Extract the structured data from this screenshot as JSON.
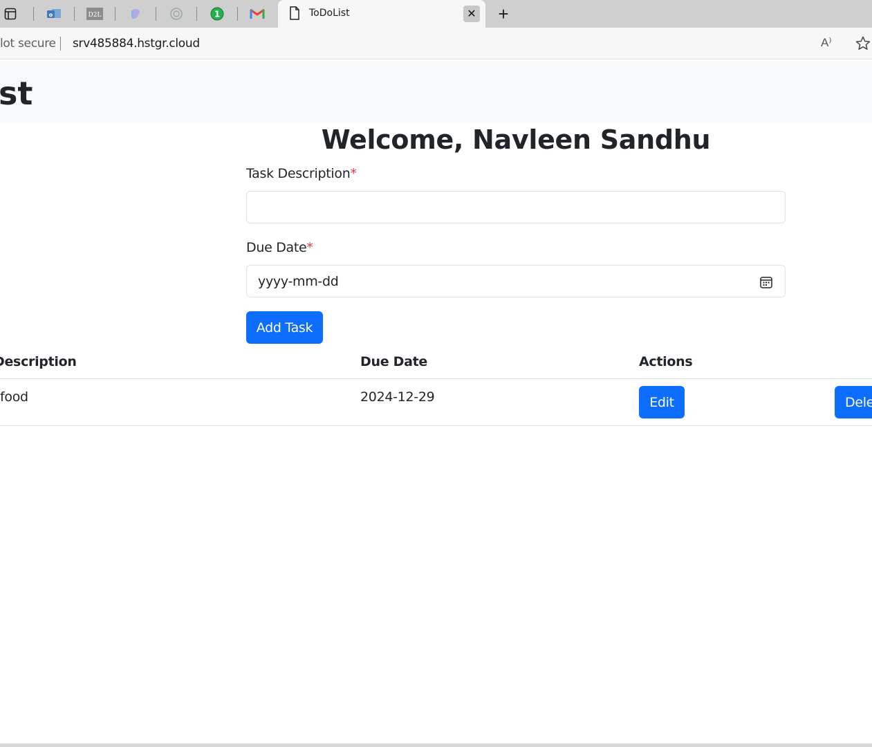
{
  "browser": {
    "active_tab_title": "ToDoList",
    "security_label": "lot secure",
    "url": "srv485884.hstgr.cloud",
    "tab_icons": [
      "tab-actions-icon",
      "outlook-icon",
      "d2l-icon",
      "copilot-icon",
      "chatgpt-icon",
      "one-password-icon",
      "gmail-icon"
    ],
    "d2l_text": "D2L",
    "one_password_text": "1",
    "gmail_text": "M",
    "read_aloud_text": "A⁾",
    "new_tab_symbol": "+",
    "close_symbol": "✕"
  },
  "app": {
    "title_fragment": "st",
    "welcome": "Welcome, Navleen Sandhu"
  },
  "form": {
    "task_label": "Task Description",
    "task_value": "",
    "due_label": "Due Date",
    "due_placeholder": "yyyy-mm-dd",
    "required_marker": "*",
    "add_button": "Add Task"
  },
  "table": {
    "headers": {
      "description": "Description",
      "due_date": "Due Date",
      "actions": "Actions"
    },
    "rows": [
      {
        "description": "food",
        "due_date": "2024-12-29",
        "edit_label": "Edit",
        "delete_label": "Dele"
      }
    ]
  },
  "colors": {
    "primary": "#0d6efd",
    "required": "#dc3545",
    "header_bg": "#f8f9fa",
    "tabstrip_bg": "#cfcfcf"
  }
}
